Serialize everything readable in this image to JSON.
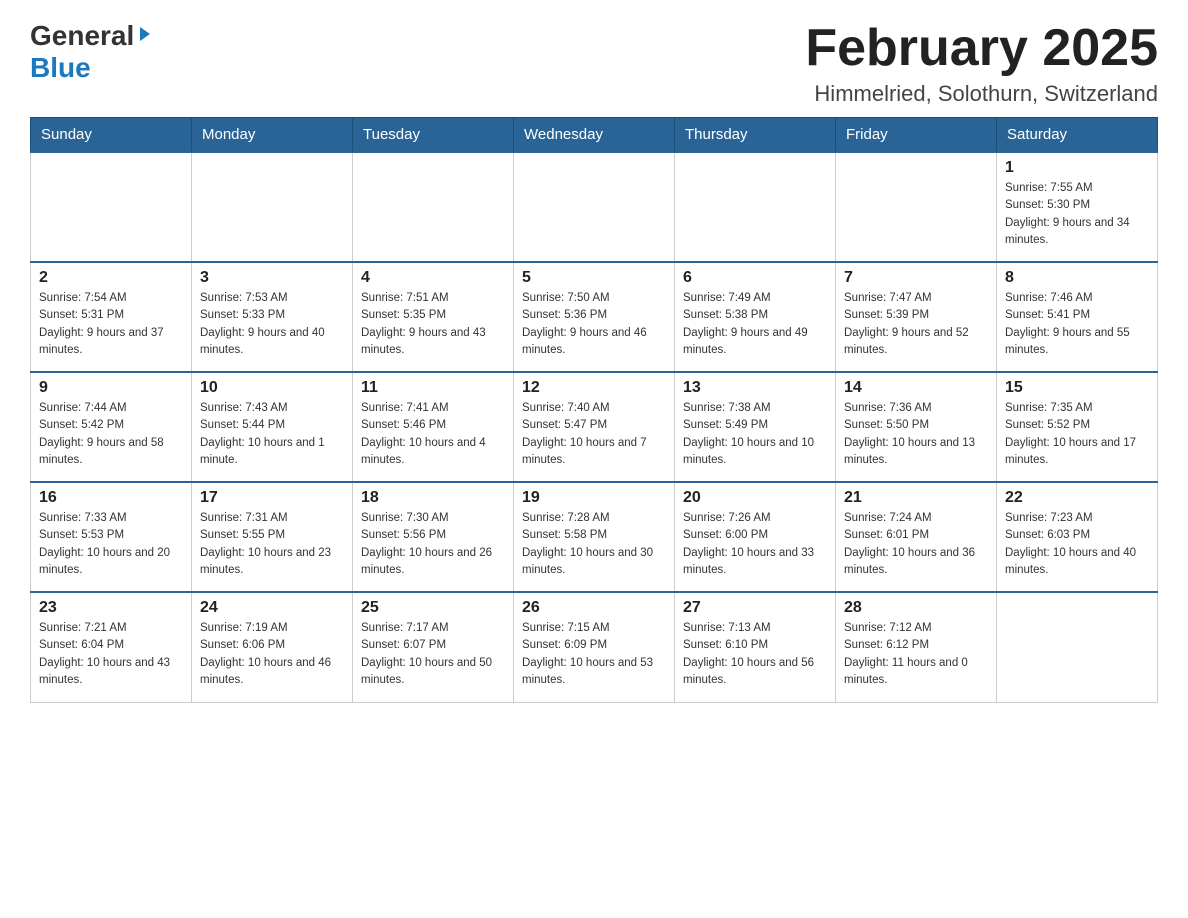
{
  "header": {
    "logo_general": "General",
    "logo_blue": "Blue",
    "month_title": "February 2025",
    "location": "Himmelried, Solothurn, Switzerland"
  },
  "days_of_week": [
    "Sunday",
    "Monday",
    "Tuesday",
    "Wednesday",
    "Thursday",
    "Friday",
    "Saturday"
  ],
  "weeks": [
    [
      {
        "day": "",
        "sunrise": "",
        "sunset": "",
        "daylight": ""
      },
      {
        "day": "",
        "sunrise": "",
        "sunset": "",
        "daylight": ""
      },
      {
        "day": "",
        "sunrise": "",
        "sunset": "",
        "daylight": ""
      },
      {
        "day": "",
        "sunrise": "",
        "sunset": "",
        "daylight": ""
      },
      {
        "day": "",
        "sunrise": "",
        "sunset": "",
        "daylight": ""
      },
      {
        "day": "",
        "sunrise": "",
        "sunset": "",
        "daylight": ""
      },
      {
        "day": "1",
        "sunrise": "Sunrise: 7:55 AM",
        "sunset": "Sunset: 5:30 PM",
        "daylight": "Daylight: 9 hours and 34 minutes."
      }
    ],
    [
      {
        "day": "2",
        "sunrise": "Sunrise: 7:54 AM",
        "sunset": "Sunset: 5:31 PM",
        "daylight": "Daylight: 9 hours and 37 minutes."
      },
      {
        "day": "3",
        "sunrise": "Sunrise: 7:53 AM",
        "sunset": "Sunset: 5:33 PM",
        "daylight": "Daylight: 9 hours and 40 minutes."
      },
      {
        "day": "4",
        "sunrise": "Sunrise: 7:51 AM",
        "sunset": "Sunset: 5:35 PM",
        "daylight": "Daylight: 9 hours and 43 minutes."
      },
      {
        "day": "5",
        "sunrise": "Sunrise: 7:50 AM",
        "sunset": "Sunset: 5:36 PM",
        "daylight": "Daylight: 9 hours and 46 minutes."
      },
      {
        "day": "6",
        "sunrise": "Sunrise: 7:49 AM",
        "sunset": "Sunset: 5:38 PM",
        "daylight": "Daylight: 9 hours and 49 minutes."
      },
      {
        "day": "7",
        "sunrise": "Sunrise: 7:47 AM",
        "sunset": "Sunset: 5:39 PM",
        "daylight": "Daylight: 9 hours and 52 minutes."
      },
      {
        "day": "8",
        "sunrise": "Sunrise: 7:46 AM",
        "sunset": "Sunset: 5:41 PM",
        "daylight": "Daylight: 9 hours and 55 minutes."
      }
    ],
    [
      {
        "day": "9",
        "sunrise": "Sunrise: 7:44 AM",
        "sunset": "Sunset: 5:42 PM",
        "daylight": "Daylight: 9 hours and 58 minutes."
      },
      {
        "day": "10",
        "sunrise": "Sunrise: 7:43 AM",
        "sunset": "Sunset: 5:44 PM",
        "daylight": "Daylight: 10 hours and 1 minute."
      },
      {
        "day": "11",
        "sunrise": "Sunrise: 7:41 AM",
        "sunset": "Sunset: 5:46 PM",
        "daylight": "Daylight: 10 hours and 4 minutes."
      },
      {
        "day": "12",
        "sunrise": "Sunrise: 7:40 AM",
        "sunset": "Sunset: 5:47 PM",
        "daylight": "Daylight: 10 hours and 7 minutes."
      },
      {
        "day": "13",
        "sunrise": "Sunrise: 7:38 AM",
        "sunset": "Sunset: 5:49 PM",
        "daylight": "Daylight: 10 hours and 10 minutes."
      },
      {
        "day": "14",
        "sunrise": "Sunrise: 7:36 AM",
        "sunset": "Sunset: 5:50 PM",
        "daylight": "Daylight: 10 hours and 13 minutes."
      },
      {
        "day": "15",
        "sunrise": "Sunrise: 7:35 AM",
        "sunset": "Sunset: 5:52 PM",
        "daylight": "Daylight: 10 hours and 17 minutes."
      }
    ],
    [
      {
        "day": "16",
        "sunrise": "Sunrise: 7:33 AM",
        "sunset": "Sunset: 5:53 PM",
        "daylight": "Daylight: 10 hours and 20 minutes."
      },
      {
        "day": "17",
        "sunrise": "Sunrise: 7:31 AM",
        "sunset": "Sunset: 5:55 PM",
        "daylight": "Daylight: 10 hours and 23 minutes."
      },
      {
        "day": "18",
        "sunrise": "Sunrise: 7:30 AM",
        "sunset": "Sunset: 5:56 PM",
        "daylight": "Daylight: 10 hours and 26 minutes."
      },
      {
        "day": "19",
        "sunrise": "Sunrise: 7:28 AM",
        "sunset": "Sunset: 5:58 PM",
        "daylight": "Daylight: 10 hours and 30 minutes."
      },
      {
        "day": "20",
        "sunrise": "Sunrise: 7:26 AM",
        "sunset": "Sunset: 6:00 PM",
        "daylight": "Daylight: 10 hours and 33 minutes."
      },
      {
        "day": "21",
        "sunrise": "Sunrise: 7:24 AM",
        "sunset": "Sunset: 6:01 PM",
        "daylight": "Daylight: 10 hours and 36 minutes."
      },
      {
        "day": "22",
        "sunrise": "Sunrise: 7:23 AM",
        "sunset": "Sunset: 6:03 PM",
        "daylight": "Daylight: 10 hours and 40 minutes."
      }
    ],
    [
      {
        "day": "23",
        "sunrise": "Sunrise: 7:21 AM",
        "sunset": "Sunset: 6:04 PM",
        "daylight": "Daylight: 10 hours and 43 minutes."
      },
      {
        "day": "24",
        "sunrise": "Sunrise: 7:19 AM",
        "sunset": "Sunset: 6:06 PM",
        "daylight": "Daylight: 10 hours and 46 minutes."
      },
      {
        "day": "25",
        "sunrise": "Sunrise: 7:17 AM",
        "sunset": "Sunset: 6:07 PM",
        "daylight": "Daylight: 10 hours and 50 minutes."
      },
      {
        "day": "26",
        "sunrise": "Sunrise: 7:15 AM",
        "sunset": "Sunset: 6:09 PM",
        "daylight": "Daylight: 10 hours and 53 minutes."
      },
      {
        "day": "27",
        "sunrise": "Sunrise: 7:13 AM",
        "sunset": "Sunset: 6:10 PM",
        "daylight": "Daylight: 10 hours and 56 minutes."
      },
      {
        "day": "28",
        "sunrise": "Sunrise: 7:12 AM",
        "sunset": "Sunset: 6:12 PM",
        "daylight": "Daylight: 11 hours and 0 minutes."
      },
      {
        "day": "",
        "sunrise": "",
        "sunset": "",
        "daylight": ""
      }
    ]
  ]
}
